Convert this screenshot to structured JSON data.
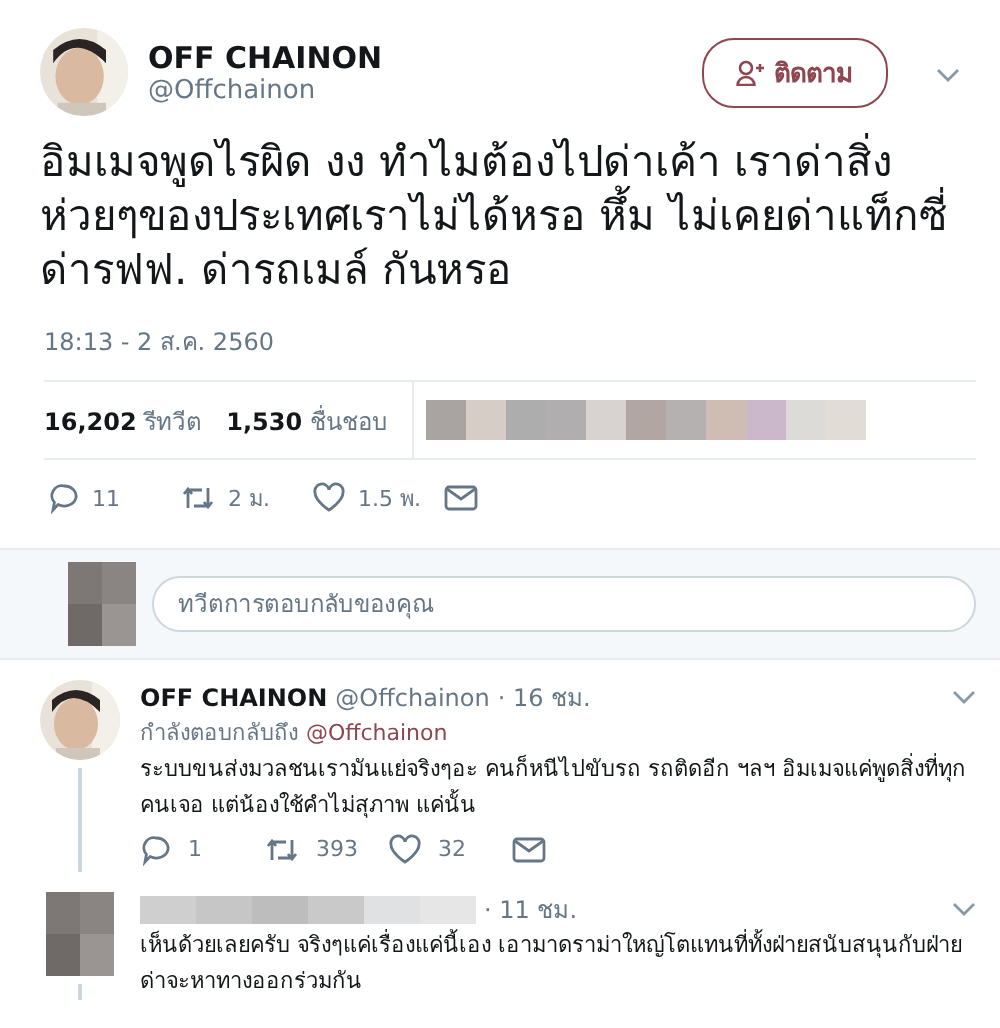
{
  "tweet": {
    "author": {
      "name": "OFF CHAINON",
      "handle": "@Offchainon"
    },
    "follow_button": "ติดตาม",
    "text": "อิมเมจพูดไรผิด งง ทำไมต้องไปด่าเค้า เราด่าสิ่งห่วยๆของประเทศเราไม่ได้หรอ หึ้ม ไม่เคยด่าแท็กซี่ ด่ารฟฟ. ด่ารถเมล์ กันหรอ",
    "timestamp": "18:13 - 2 ส.ค. 2560",
    "stats": [
      {
        "count": "16,202",
        "label": "รีทวีต"
      },
      {
        "count": "1,530",
        "label": "ชื่นชอบ"
      }
    ],
    "actions": [
      {
        "kind": "reply",
        "count": "11"
      },
      {
        "kind": "retweet",
        "count": "2 ม."
      },
      {
        "kind": "like",
        "count": "1.5 พ."
      },
      {
        "kind": "message"
      }
    ]
  },
  "reply_box": {
    "placeholder": "ทวีตการตอบกลับของคุณ"
  },
  "replies": [
    {
      "name": "OFF CHAINON",
      "handle": "@Offchainon",
      "time": "· 16 ชม.",
      "replying_label": "กำลังตอบกลับถึง",
      "replying_to": "@Offchainon",
      "text": "ระบบขนส่งมวลชนเรามันแย่จริงๆอะ คนก็หนีไปขับรถ รถติดอีก ฯลฯ อิมเมจแค่พูดสิ่งที่ทุกคนเจอ แต่น้องใช้คำไม่สุภาพ แค่นั้น",
      "actions": [
        {
          "kind": "reply",
          "count": "1"
        },
        {
          "kind": "retweet",
          "count": "393"
        },
        {
          "kind": "like",
          "count": "32"
        },
        {
          "kind": "message"
        }
      ]
    },
    {
      "time": "· 11 ชม.",
      "text": "เห็นด้วยเลยครับ  จริงๆแค่เรื่องแค่นี้เอง  เอามาดราม่าใหญ่โตแทนที่ทั้งฝ่ายสนับสนุนกับฝ่ายด่าจะหาทางออกร่วมกัน"
    }
  ]
}
